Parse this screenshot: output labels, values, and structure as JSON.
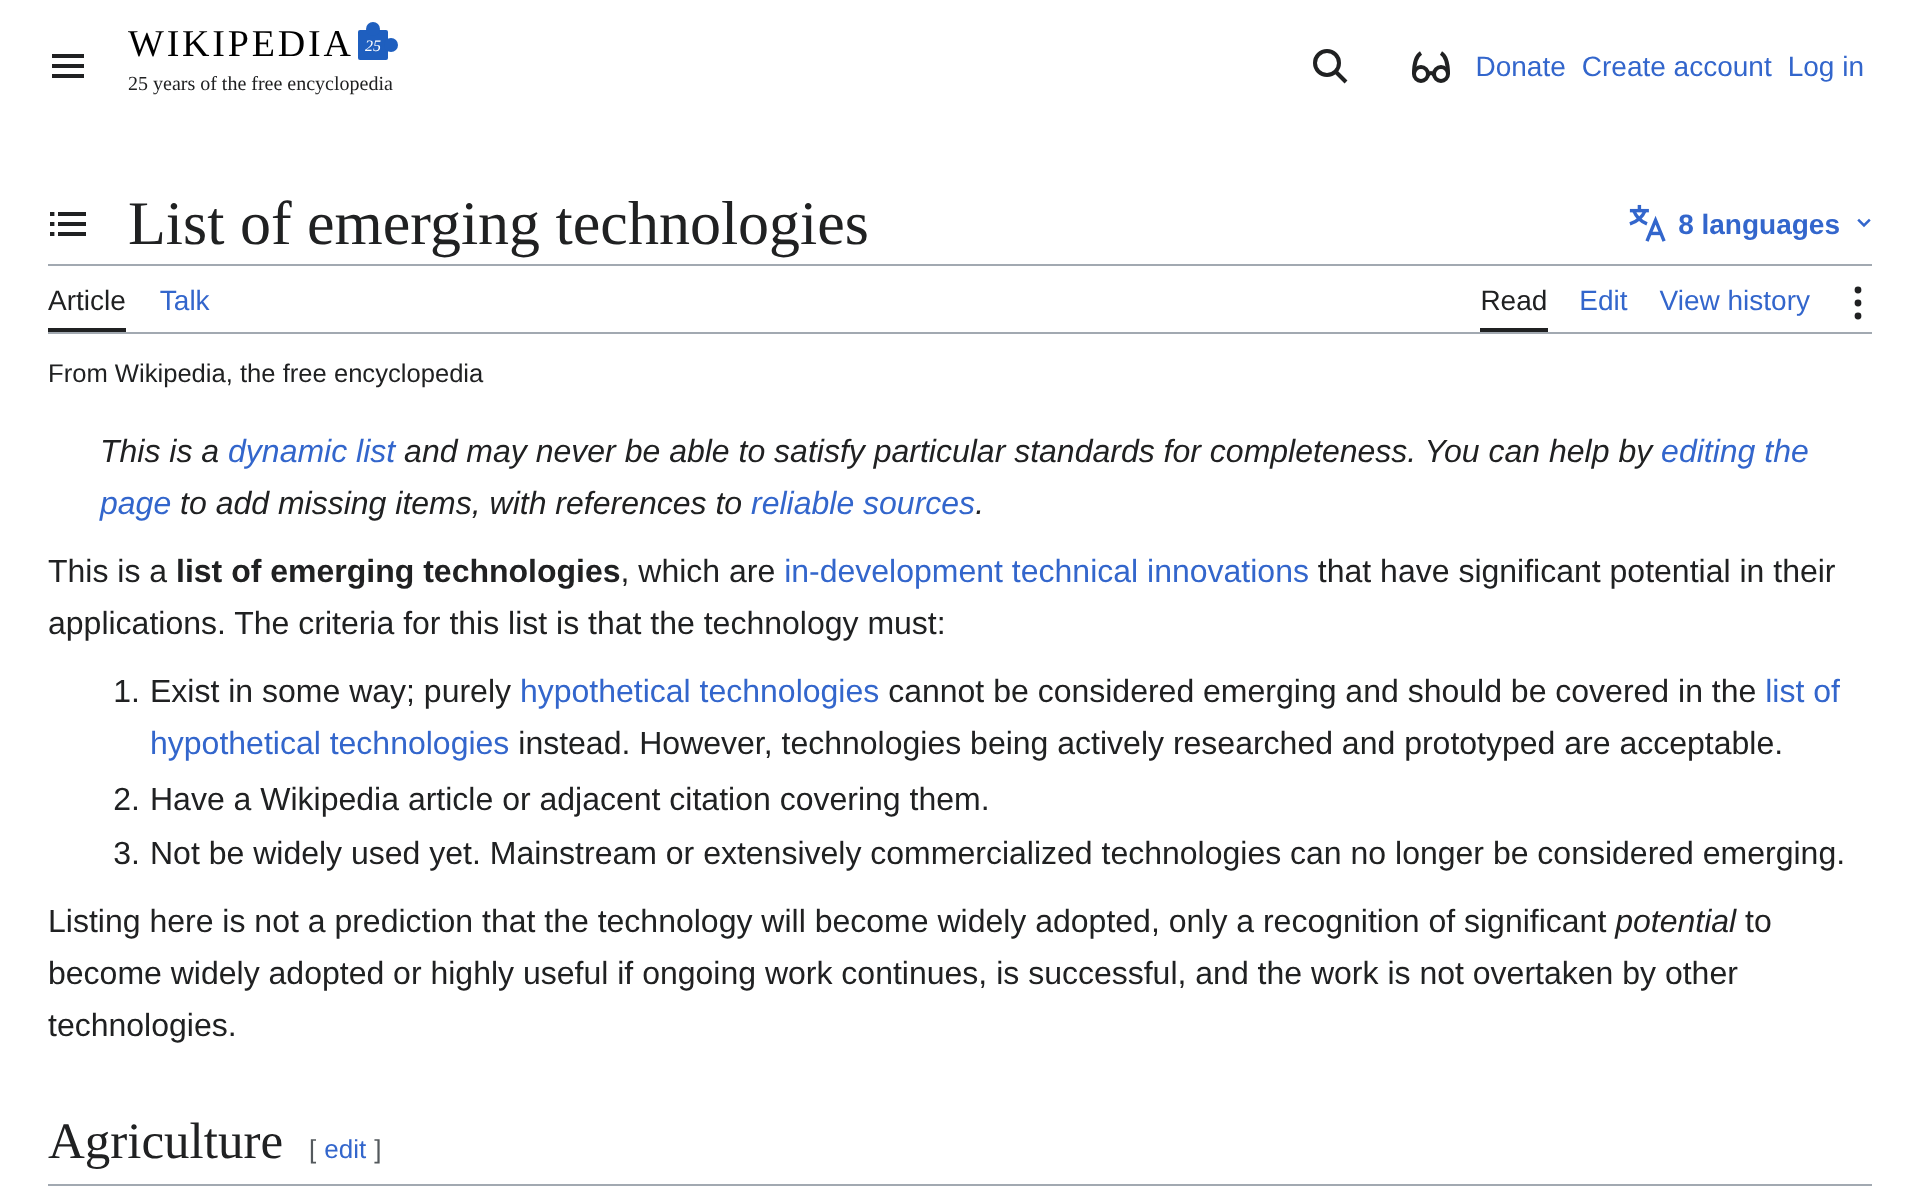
{
  "header": {
    "logo": {
      "wordmark": "WIKIPEDIA",
      "emblem_text": "25",
      "tagline": "25 years of the free encyclopedia"
    },
    "links": [
      "Donate",
      "Create account",
      "Log in"
    ]
  },
  "page": {
    "title": "List of emerging technologies",
    "languages": "8 languages",
    "namespace_tabs": [
      {
        "label": "Article",
        "selected": true
      },
      {
        "label": "Talk",
        "selected": false
      }
    ],
    "view_tabs": [
      {
        "label": "Read",
        "selected": true
      },
      {
        "label": "Edit",
        "selected": false
      },
      {
        "label": "View history",
        "selected": false
      }
    ]
  },
  "site_sub": "From Wikipedia, the free encyclopedia",
  "content": [
    {
      "kind": "hatnote",
      "segments": [
        {
          "kind": "text",
          "text": "This is a "
        },
        {
          "kind": "link",
          "text": "dynamic list"
        },
        {
          "kind": "text",
          "text": " and may never be able to satisfy particular standards for completeness. You can help by "
        },
        {
          "kind": "link",
          "text": "editing the"
        },
        {
          "kind": "link",
          "text": "page"
        },
        {
          "kind": "text",
          "text": " to add missing items, with references to "
        },
        {
          "kind": "link",
          "text": "reliable sources"
        },
        {
          "kind": "text",
          "text": "."
        }
      ]
    },
    {
      "kind": "paragraph",
      "segments": [
        {
          "kind": "text",
          "text": "This is a "
        },
        {
          "kind": "bold",
          "text": "list of emerging technologies"
        },
        {
          "kind": "text",
          "text": ", which are "
        },
        {
          "kind": "link",
          "text": "in-development technical innovations"
        },
        {
          "kind": "text",
          "text": " that have significant potential in their applications. The criteria for this list is that the technology must:"
        }
      ]
    },
    {
      "kind": "list",
      "items": [
        {
          "number": "1.",
          "segments": [
            {
              "kind": "text",
              "text": "Exist in some way; purely "
            },
            {
              "kind": "link",
              "text": "hypothetical technologies"
            },
            {
              "kind": "text",
              "text": " cannot be considered emerging and should be covered in the "
            },
            {
              "kind": "link",
              "text": "list of"
            },
            {
              "kind": "link",
              "text": "hypothetical technologies"
            },
            {
              "kind": "text",
              "text": " instead. However, technologies being actively researched and prototyped are acceptable."
            }
          ]
        },
        {
          "number": "2.",
          "segments": [
            {
              "kind": "text",
              "text": "Have a Wikipedia article or adjacent citation covering them."
            }
          ]
        },
        {
          "number": "3.",
          "segments": [
            {
              "kind": "text",
              "text": "Not be widely used yet. Mainstream or extensively commercialized technologies can no longer be considered emerging."
            }
          ]
        }
      ]
    },
    {
      "kind": "paragraph",
      "segments": [
        {
          "kind": "text",
          "text": "Listing here is not a prediction that the technology will become widely adopted, only a recognition of significant "
        },
        {
          "kind": "italic",
          "text": "potential"
        },
        {
          "kind": "text",
          "text": " to become widely adopted or highly useful if ongoing work continues, is successful, and the work is not overtaken by other technologies."
        }
      ]
    },
    {
      "kind": "heading",
      "text": "Agriculture",
      "edit": {
        "open": "[",
        "label": "edit",
        "close": "]"
      }
    }
  ]
}
